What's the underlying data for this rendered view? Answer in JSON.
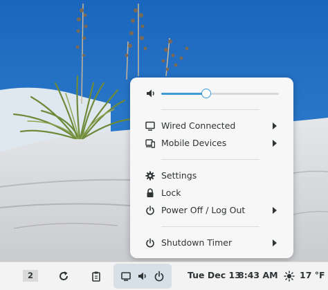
{
  "panel": {
    "volume_level": 0.38,
    "items": [
      {
        "label": "Wired Connected",
        "icon": "monitor-icon",
        "submenu": true
      },
      {
        "label": "Mobile Devices",
        "icon": "devices-icon",
        "submenu": true
      },
      {
        "label": "Settings",
        "icon": "gear-icon",
        "submenu": false
      },
      {
        "label": "Lock",
        "icon": "lock-icon",
        "submenu": false
      },
      {
        "label": "Power Off / Log Out",
        "icon": "power-icon",
        "submenu": true
      },
      {
        "label": "Shutdown Timer",
        "icon": "power-icon",
        "submenu": true
      }
    ]
  },
  "taskbar": {
    "workspace": "2",
    "date": "Tue Dec 13",
    "time": "8:43 AM",
    "temperature": "17 °F",
    "weather_icon": "sun-icon"
  },
  "colors": {
    "accent": "#3d9ad6",
    "sky": "#1d6fc4",
    "panel_bg": "#f7f7f7",
    "taskbar_bg": "#f3f3f3"
  }
}
